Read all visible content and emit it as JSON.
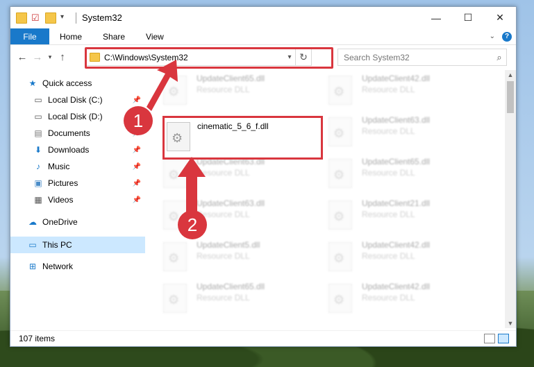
{
  "window": {
    "title": "System32",
    "minimize": "—",
    "maximize": "☐",
    "close": "✕"
  },
  "ribbon": {
    "tabs": [
      "File",
      "Home",
      "Share",
      "View"
    ]
  },
  "address": {
    "path": "C:\\Windows\\System32"
  },
  "search": {
    "placeholder": "Search System32"
  },
  "sidebar": {
    "quick_access": "Quick access",
    "items": [
      "Local Disk (C:)",
      "Local Disk (D:)",
      "Documents",
      "Downloads",
      "Music",
      "Pictures",
      "Videos"
    ],
    "onedrive": "OneDrive",
    "this_pc": "This PC",
    "network": "Network"
  },
  "files": {
    "col1": [
      {
        "name": "UpdateClient65.dll",
        "type": "Resource DLL"
      },
      {
        "name": "UpdateClient63.dll",
        "type": "Resource DLL"
      },
      {
        "name": "UpdateClient63.dll",
        "type": "Resource DLL"
      },
      {
        "name": "UpdateClient5.dll",
        "type": "Resource DLL"
      },
      {
        "name": "UpdateClient65.dll",
        "type": "Resource DLL"
      }
    ],
    "col2": [
      {
        "name": "UpdateClient42.dll",
        "type": "Resource DLL"
      },
      {
        "name": "UpdateClient63.dll",
        "type": "Resource DLL"
      },
      {
        "name": "UpdateClient65.dll",
        "type": "Resource DLL"
      },
      {
        "name": "UpdateClient21.dll",
        "type": "Resource DLL"
      },
      {
        "name": "UpdateClient42.dll",
        "type": "Resource DLL"
      },
      {
        "name": "UpdateClient42.dll",
        "type": "Resource DLL"
      }
    ],
    "highlighted": "cinematic_5_6_f.dll"
  },
  "status": {
    "count": "107 items"
  },
  "callouts": [
    "1",
    "2"
  ],
  "colors": {
    "accent": "#1979ca",
    "highlight": "#d9363e"
  }
}
